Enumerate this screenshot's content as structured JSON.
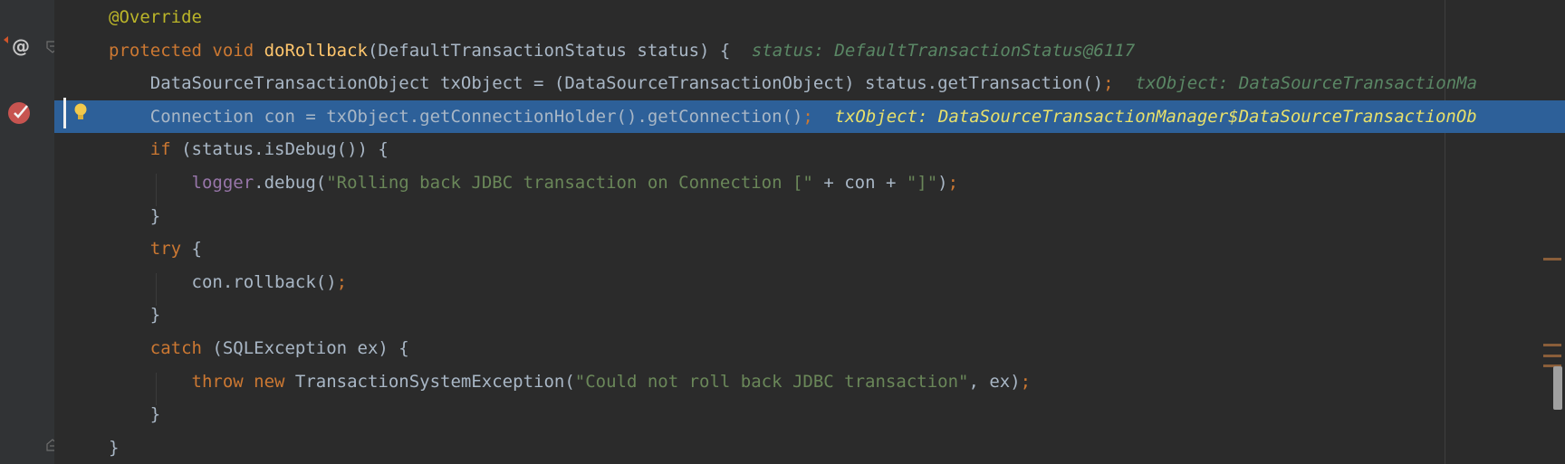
{
  "lines": [
    {
      "code": [
        {
          "t": "@Override",
          "c": "ann"
        }
      ]
    },
    {
      "code": [
        {
          "t": "protected void ",
          "c": "kw"
        },
        {
          "t": "doRollback",
          "c": "fn"
        },
        {
          "t": "(DefaultTransactionStatus status) {"
        }
      ],
      "hint": "status: DefaultTransactionStatus@6117"
    },
    {
      "code": [
        {
          "t": "    DataSourceTransactionObject txObject = (DataSourceTransactionObject) status.getTransaction()"
        },
        {
          "t": ";",
          "c": "semi"
        }
      ],
      "hint": "txObject: DataSourceTransactionMa"
    },
    {
      "code": [
        {
          "t": "    Connection con = txObject.getConnectionHolder().getConnection()"
        },
        {
          "t": ";",
          "c": "semi"
        }
      ],
      "hint": "txObject: DataSourceTransactionManager$DataSourceTransactionOb",
      "highlight": true
    },
    {
      "code": [
        {
          "t": "    "
        },
        {
          "t": "if ",
          "c": "kw"
        },
        {
          "t": "(status.isDebug()) {"
        }
      ]
    },
    {
      "code": [
        {
          "t": "        "
        },
        {
          "t": "logger",
          "c": "field"
        },
        {
          "t": ".debug("
        },
        {
          "t": "\"Rolling back JDBC transaction on Connection [\"",
          "c": "str"
        },
        {
          "t": " + con + "
        },
        {
          "t": "\"]\"",
          "c": "str"
        },
        {
          "t": ")"
        },
        {
          "t": ";",
          "c": "semi"
        }
      ]
    },
    {
      "code": [
        {
          "t": "    }"
        }
      ]
    },
    {
      "code": [
        {
          "t": "    "
        },
        {
          "t": "try ",
          "c": "kw"
        },
        {
          "t": "{"
        }
      ]
    },
    {
      "code": [
        {
          "t": "        con.rollback()"
        },
        {
          "t": ";",
          "c": "semi"
        }
      ]
    },
    {
      "code": [
        {
          "t": "    }"
        }
      ]
    },
    {
      "code": [
        {
          "t": "    "
        },
        {
          "t": "catch ",
          "c": "kw"
        },
        {
          "t": "(SQLException ex) {"
        }
      ]
    },
    {
      "code": [
        {
          "t": "        "
        },
        {
          "t": "throw new ",
          "c": "kw"
        },
        {
          "t": "TransactionSystemException("
        },
        {
          "t": "\"Could not roll back JDBC transaction\"",
          "c": "str"
        },
        {
          "t": ", ex)"
        },
        {
          "t": ";",
          "c": "semi"
        }
      ]
    },
    {
      "code": [
        {
          "t": "    }"
        }
      ]
    },
    {
      "code": [
        {
          "t": "}"
        }
      ]
    }
  ],
  "gutter_icons": {
    "override": "@",
    "breakpoint": "breakpoint-check-icon"
  }
}
